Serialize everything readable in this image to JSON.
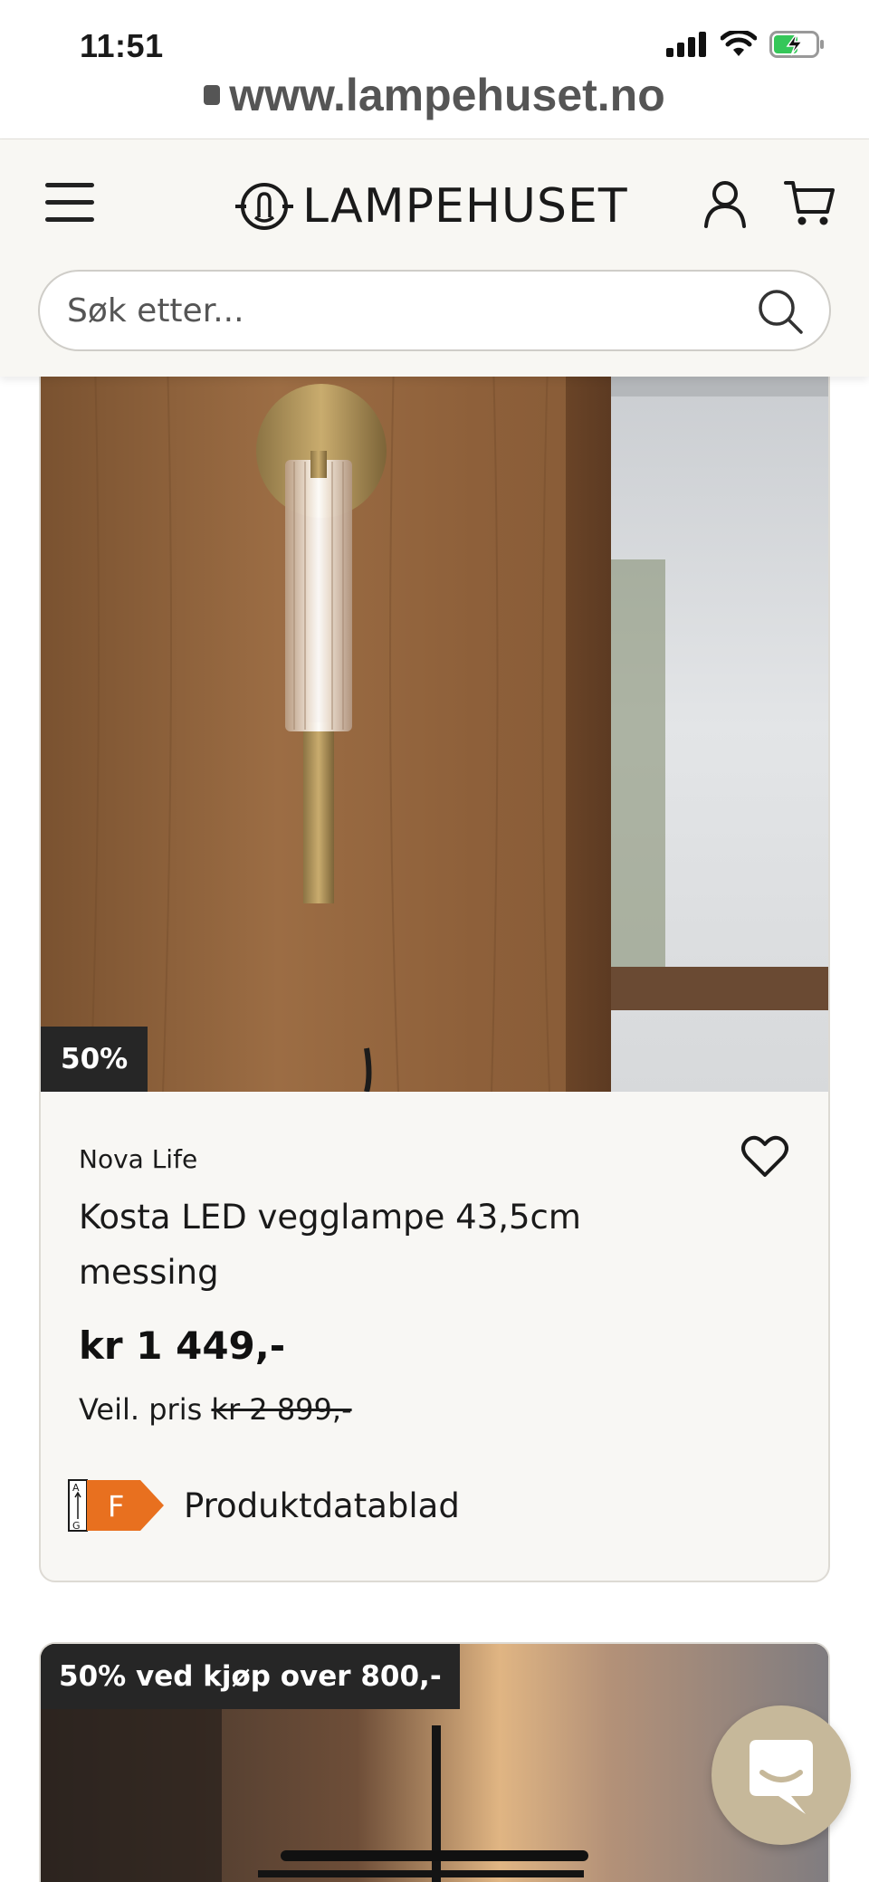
{
  "status_bar": {
    "time": "11:51",
    "icons": [
      "cellular-signal-icon",
      "wifi-icon",
      "battery-charging-icon"
    ]
  },
  "browser": {
    "url": "www.lampehuset.no"
  },
  "header": {
    "logo_text": "LAMPEHUSET",
    "icons": [
      "menu-icon",
      "user-icon",
      "cart-icon"
    ],
    "search": {
      "placeholder": "Søk etter...",
      "value": ""
    }
  },
  "product": {
    "discount_badge": "50%",
    "brand": "Nova Life",
    "title": "Kosta LED vegglampe 43,5cm messing",
    "price": "kr 1 449,-",
    "regular_price_label": "Veil. pris",
    "regular_price": "kr 2 899,-",
    "energy_class": "F",
    "energy_scale_top": "A",
    "energy_scale_bottom": "G",
    "energy_link": "Produktdatablad"
  },
  "next_product": {
    "promo_badge": "50% ved kjøp over 800,-"
  },
  "colors": {
    "header_bg": "#f8f7f3",
    "card_bg": "#f8f7f4",
    "badge_bg": "#262626",
    "energy_orange": "#e8701f",
    "chat_bubble": "#c6b89a"
  }
}
